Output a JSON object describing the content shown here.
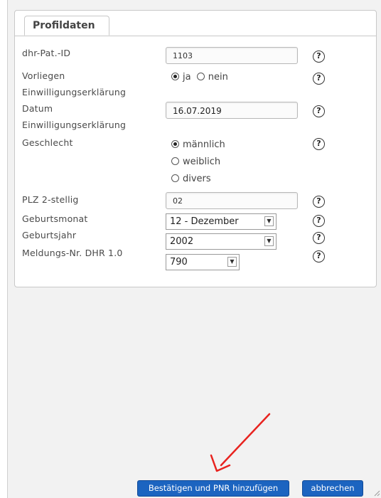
{
  "tab": {
    "label": "Profildaten"
  },
  "fields": {
    "pat_id": {
      "label": "dhr-Pat.-ID",
      "value": "1103"
    },
    "consent": {
      "label_line1": "Vorliegen",
      "label_line2": "Einwilligungserklärung",
      "option_yes": "ja",
      "option_no": "nein",
      "selected": "ja"
    },
    "consent_date": {
      "label_line1": "Datum",
      "label_line2": "Einwilligungserklärung",
      "value": "16.07.2019"
    },
    "gender": {
      "label": "Geschlecht",
      "options": [
        "männlich",
        "weiblich",
        "divers"
      ],
      "selected": "männlich"
    },
    "plz": {
      "label": "PLZ 2-stellig",
      "value": "02"
    },
    "birth_month": {
      "label": "Geburtsmonat",
      "value": "12 - Dezember"
    },
    "birth_year": {
      "label": "Geburtsjahr",
      "value": "2002"
    },
    "report_no": {
      "label": "Meldungs-Nr. DHR 1.0",
      "value": "790"
    }
  },
  "help": {
    "glyph": "?"
  },
  "buttons": {
    "confirm": "Bestätigen und PNR hinzufügen",
    "cancel": "abbrechen"
  },
  "colors": {
    "button_bg": "#1c64c0",
    "annotation_arrow": "#e8231f"
  }
}
